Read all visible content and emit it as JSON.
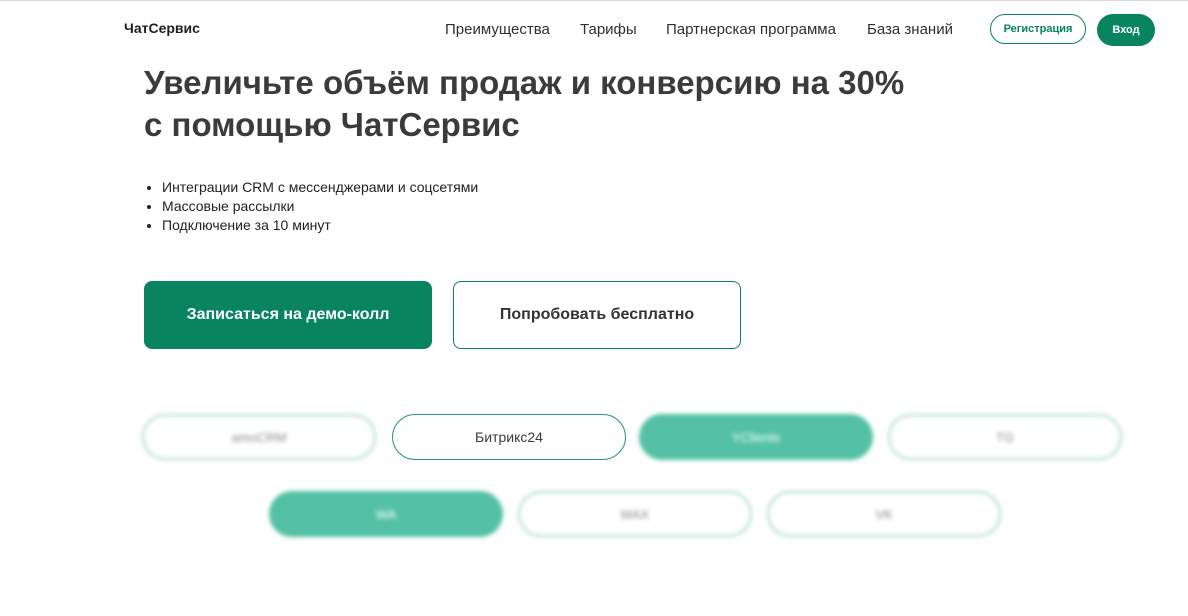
{
  "header": {
    "logo": "ЧатСервис",
    "nav": [
      "Преимущества",
      "Тарифы",
      "Партнерская программа",
      "База знаний"
    ],
    "register_label": "Регистрация",
    "login_label": "Вход"
  },
  "hero": {
    "headline_line1": "Увеличьте объём продаж и конверсию на 30%",
    "headline_line2": "с помощью ЧатСервис",
    "features": [
      "Интеграции CRM с мессенджерами и соцсетями",
      "Массовые рассылки",
      "Подключение за 10 минут"
    ],
    "cta_primary": "Записаться на демо-колл",
    "cta_secondary": "Попробовать бесплатно"
  },
  "integrations": {
    "row1": [
      "amoCRM",
      "Битрикс24",
      "YClients",
      "TG"
    ],
    "row2": [
      "WA",
      "MAX",
      "VK"
    ]
  },
  "colors": {
    "brand": "#08845f",
    "pill_fill": "#54c1a4",
    "pill_border": "#a9dcc9"
  }
}
